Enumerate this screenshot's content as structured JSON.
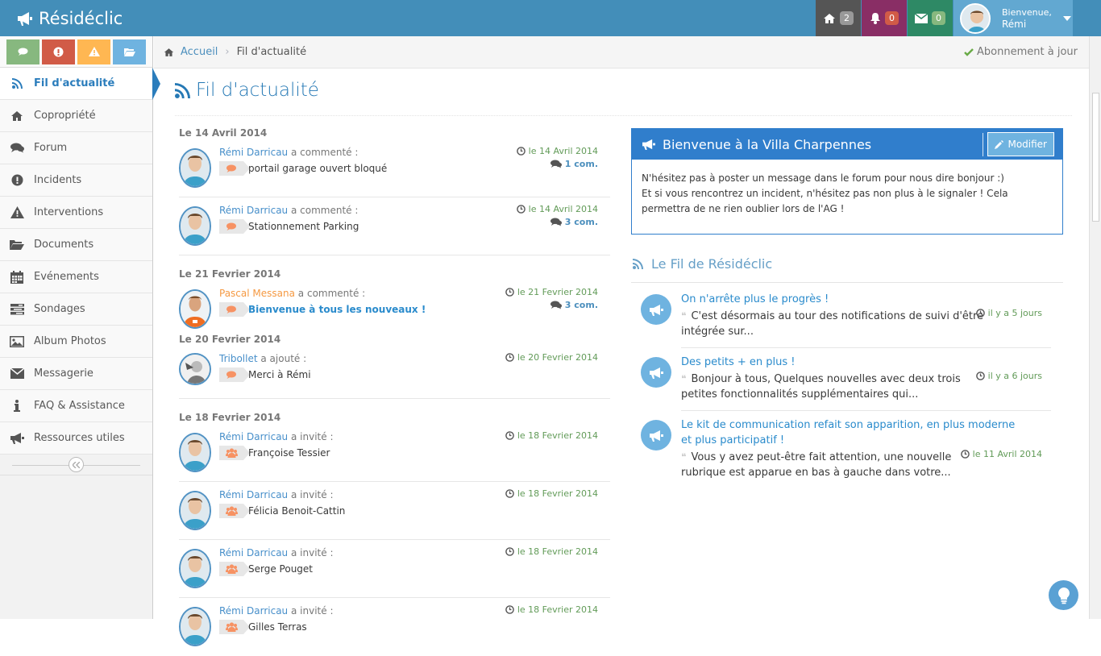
{
  "app": {
    "name": "Résidéclic"
  },
  "topbar": {
    "home_count": "2",
    "notif_count": "0",
    "mail_count": "0",
    "welcome_label": "Bienvenue,",
    "user_name": "Rémi"
  },
  "shortcuts": [
    {
      "icon": "comments-icon",
      "color": "#87b87f"
    },
    {
      "icon": "exclamation-circle-icon",
      "color": "#d15b47"
    },
    {
      "icon": "warning-icon",
      "color": "#ffb752"
    },
    {
      "icon": "folder-open-icon",
      "color": "#6fb3e0"
    }
  ],
  "sidebar": {
    "items": [
      {
        "label": "Fil d'actualité",
        "icon": "rss-icon"
      },
      {
        "label": "Copropriété",
        "icon": "home-icon"
      },
      {
        "label": "Forum",
        "icon": "comments-icon"
      },
      {
        "label": "Incidents",
        "icon": "exclamation-circle-icon"
      },
      {
        "label": "Interventions",
        "icon": "warning-icon"
      },
      {
        "label": "Documents",
        "icon": "folder-open-icon"
      },
      {
        "label": "Evénements",
        "icon": "calendar-icon"
      },
      {
        "label": "Sondages",
        "icon": "tasks-icon"
      },
      {
        "label": "Album Photos",
        "icon": "picture-icon"
      },
      {
        "label": "Messagerie",
        "icon": "envelope-icon"
      },
      {
        "label": "FAQ & Assistance",
        "icon": "info-icon"
      },
      {
        "label": "Ressources utiles",
        "icon": "bullhorn-icon"
      }
    ]
  },
  "breadcrumb": {
    "home": "Accueil",
    "current": "Fil d'actualité",
    "subscription": "Abonnement à jour"
  },
  "page": {
    "title": "Fil d'actualité"
  },
  "feed": {
    "day1": "Le 14 Avril 2014",
    "day2": "Le 21 Fevrier 2014",
    "day3": "Le 20 Fevrier 2014",
    "day4": "Le 18 Fevrier 2014",
    "items": [
      {
        "name": "Rémi Darricau",
        "action": "a commenté :",
        "title": "portail garage ouvert bloqué",
        "date": "le 14 Avril 2014",
        "comments": "1 com."
      },
      {
        "name": "Rémi Darricau",
        "action": "a commenté :",
        "title": "Stationnement Parking",
        "date": "le 14 Avril 2014",
        "comments": "3 com."
      },
      {
        "name": "Pascal Messana",
        "action": "a commenté :",
        "title": "Bienvenue à tous les nouveaux !",
        "date": "le 21 Fevrier 2014",
        "comments": "3 com."
      },
      {
        "name": "Tribollet",
        "action": "a ajouté :",
        "title": "Merci à Rémi",
        "date": "le 20 Fevrier 2014"
      },
      {
        "name": "Rémi Darricau",
        "action": "a invité :",
        "title": "Françoise Tessier",
        "date": "le 18 Fevrier 2014"
      },
      {
        "name": "Rémi Darricau",
        "action": "a invité :",
        "title": "Félicia Benoit-Cattin",
        "date": "le 18 Fevrier 2014"
      },
      {
        "name": "Rémi Darricau",
        "action": "a invité :",
        "title": "Serge Pouget",
        "date": "le 18 Fevrier 2014"
      },
      {
        "name": "Rémi Darricau",
        "action": "a invité :",
        "title": "Gilles Terras",
        "date": "le 18 Fevrier 2014"
      }
    ]
  },
  "welcome_box": {
    "title": "Bienvenue à la Villa Charpennes",
    "edit_label": "Modifier",
    "line1": "N'hésitez pas à poster un message dans le forum pour nous dire bonjour :)",
    "line2": "Et si vous rencontrez un incident, n'hésitez pas non plus à le signaler ! Cela permettra de ne rien oublier lors de l'AG !"
  },
  "news": {
    "title": "Le Fil de Résidéclic",
    "items": [
      {
        "title": "On n'arrête plus le progrès !",
        "body": "C'est désormais au tour des notifications de suivi d'être intégrée sur...",
        "date": "il y a 5 jours"
      },
      {
        "title": "Des petits + en plus !",
        "body": "Bonjour à tous,  Quelques nouvelles avec deux trois petites fonctionnalités supplémentaires qui...",
        "date": "il y a 6 jours"
      },
      {
        "title": "Le kit de communication refait son apparition, en plus moderne et plus participatif !",
        "body": "Vous y avez peut-être fait attention, une nouvelle rubrique est apparue en bas à gauche dans votre...",
        "date": "le 11 Avril 2014"
      }
    ]
  }
}
